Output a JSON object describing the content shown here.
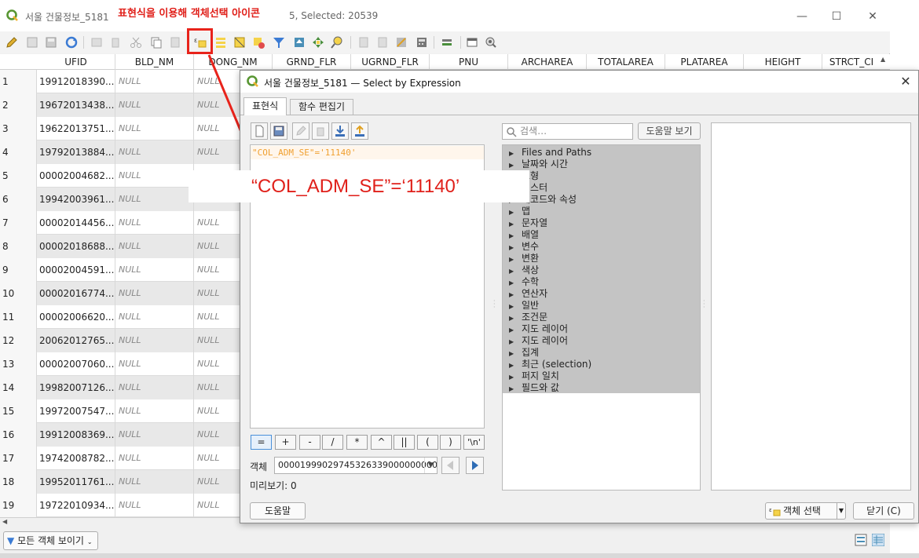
{
  "main_window": {
    "title": "서울 건물정보_5181",
    "title_tail": "5, Selected: 20539",
    "controls": {
      "minimize": "—",
      "maximize": "☐",
      "close": "✕"
    }
  },
  "annotation": {
    "title": "표현식을 이용해 객체선택 아이콘",
    "expression_callout": "“COL_ADM_SE”=‘11140’",
    "color": "#e0201a"
  },
  "table": {
    "columns": [
      "UFID",
      "BLD_NM",
      "DONG_NM",
      "GRND_FLR",
      "UGRND_FLR",
      "PNU",
      "ARCHAREA",
      "TOTALAREA",
      "PLATAREA",
      "HEIGHT",
      "STRCT_CI"
    ],
    "null_label": "NULL",
    "rows": [
      {
        "num": "1",
        "ufid": "19912018390...",
        "bld_nm": "NULL",
        "dong_nm": "NULL"
      },
      {
        "num": "2",
        "ufid": "19672013438...",
        "bld_nm": "NULL",
        "dong_nm": "NULL"
      },
      {
        "num": "3",
        "ufid": "19622013751...",
        "bld_nm": "NULL",
        "dong_nm": "NULL"
      },
      {
        "num": "4",
        "ufid": "19792013884...",
        "bld_nm": "NULL",
        "dong_nm": "NULL"
      },
      {
        "num": "5",
        "ufid": "00002004682...",
        "bld_nm": "NULL",
        "dong_nm": ""
      },
      {
        "num": "6",
        "ufid": "19942003961...",
        "bld_nm": "NULL",
        "dong_nm": ""
      },
      {
        "num": "7",
        "ufid": "00002014456...",
        "bld_nm": "NULL",
        "dong_nm": "NULL"
      },
      {
        "num": "8",
        "ufid": "00002018688...",
        "bld_nm": "NULL",
        "dong_nm": "NULL"
      },
      {
        "num": "9",
        "ufid": "00002004591...",
        "bld_nm": "NULL",
        "dong_nm": "NULL"
      },
      {
        "num": "10",
        "ufid": "00002016774...",
        "bld_nm": "NULL",
        "dong_nm": "NULL"
      },
      {
        "num": "11",
        "ufid": "00002006620...",
        "bld_nm": "NULL",
        "dong_nm": "NULL"
      },
      {
        "num": "12",
        "ufid": "20062012765...",
        "bld_nm": "NULL",
        "dong_nm": "NULL"
      },
      {
        "num": "13",
        "ufid": "00002007060...",
        "bld_nm": "NULL",
        "dong_nm": "NULL"
      },
      {
        "num": "14",
        "ufid": "19982007126...",
        "bld_nm": "NULL",
        "dong_nm": "NULL"
      },
      {
        "num": "15",
        "ufid": "19972007547...",
        "bld_nm": "NULL",
        "dong_nm": "NULL"
      },
      {
        "num": "16",
        "ufid": "19912008369...",
        "bld_nm": "NULL",
        "dong_nm": "NULL"
      },
      {
        "num": "17",
        "ufid": "19742008782...",
        "bld_nm": "NULL",
        "dong_nm": "NULL"
      },
      {
        "num": "18",
        "ufid": "19952011761...",
        "bld_nm": "NULL",
        "dong_nm": "NULL"
      },
      {
        "num": "19",
        "ufid": "19722010934...",
        "bld_nm": "NULL",
        "dong_nm": "NULL"
      }
    ]
  },
  "bottom_bar": {
    "show_all_label": "모든 객체 보이기"
  },
  "dialog": {
    "title": "서울 건물정보_5181 — Select by Expression",
    "tabs": [
      "표현식",
      "함수 편집기"
    ],
    "expression": "\"COL_ADM_SE\"='11140'",
    "operators": [
      "=",
      "+",
      "-",
      "/",
      "*",
      "^",
      "||",
      "(",
      ")",
      "'\\n'"
    ],
    "feature_label": "객체",
    "feature_value": "00001999029745326339000000000",
    "preview": "미리보기: 0",
    "help_label": "도움말",
    "search_placeholder": "검색…",
    "help_toggle_label": "도움말 보기",
    "function_groups": [
      "Files and Paths",
      "날짜와 시간",
      "도형",
      "래스터",
      "레코드와 속성",
      "맵",
      "문자열",
      "배열",
      "변수",
      "변환",
      "색상",
      "수학",
      "연산자",
      "일반",
      "조건문",
      "지도 레이어",
      "지도 레이어",
      "집계",
      "최근 (selection)",
      "퍼지 일치",
      "필드와 값"
    ],
    "select_button_label": "객체 선택",
    "close_button_label": "닫기 (C)",
    "close_icon": "✕"
  }
}
